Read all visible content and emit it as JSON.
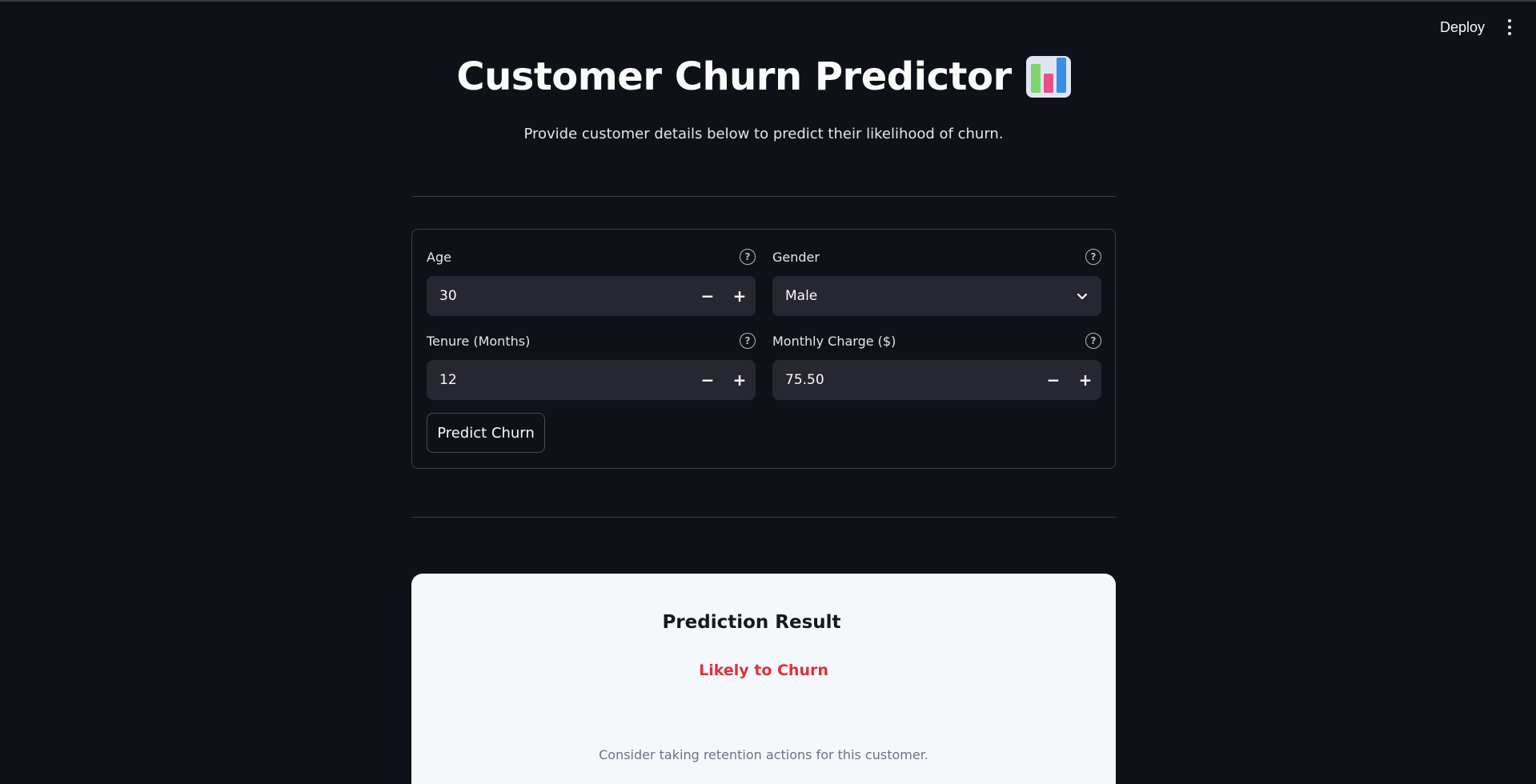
{
  "header": {
    "deploy_label": "Deploy"
  },
  "page": {
    "title": "Customer Churn Predictor",
    "subtitle": "Provide customer details below to predict their likelihood of churn."
  },
  "form": {
    "age": {
      "label": "Age",
      "value": "30"
    },
    "gender": {
      "label": "Gender",
      "value": "Male"
    },
    "tenure": {
      "label": "Tenure (Months)",
      "value": "12"
    },
    "monthly_charge": {
      "label": "Monthly Charge ($)",
      "value": "75.50"
    },
    "help_glyph": "?",
    "minus_glyph": "−",
    "plus_glyph": "+",
    "submit_label": "Predict Churn"
  },
  "result": {
    "title": "Prediction Result",
    "status": "Likely to Churn",
    "note": "Consider taking retention actions for this customer."
  },
  "colors": {
    "background": "#0e1117",
    "input_bg": "#262730",
    "result_card_bg": "#f5f8fb",
    "churn_red": "#e0303a"
  }
}
